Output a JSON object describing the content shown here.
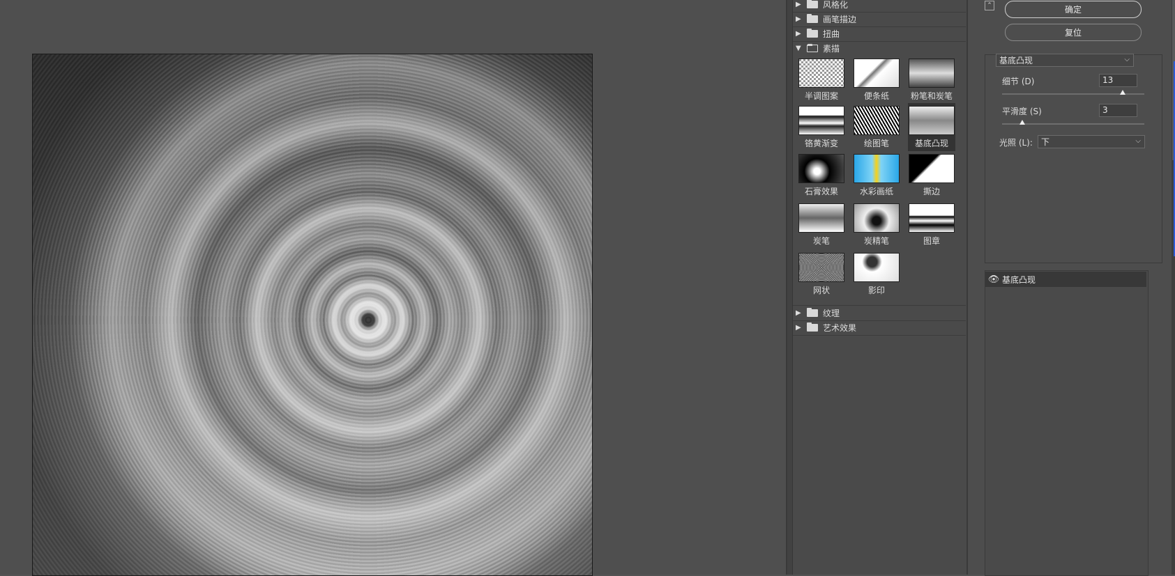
{
  "gallery": {
    "categories_top": [
      {
        "label": "风格化",
        "expanded": false
      },
      {
        "label": "画笔描边",
        "expanded": false
      },
      {
        "label": "扭曲",
        "expanded": false
      },
      {
        "label": "素描",
        "expanded": true
      }
    ],
    "sketch_filters": [
      {
        "label": "半调图案"
      },
      {
        "label": "便条纸"
      },
      {
        "label": "粉笔和炭笔"
      },
      {
        "label": "铬黄渐变"
      },
      {
        "label": "绘图笔"
      },
      {
        "label": "基底凸现",
        "selected": true
      },
      {
        "label": "石膏效果"
      },
      {
        "label": "水彩画纸"
      },
      {
        "label": "撕边"
      },
      {
        "label": "炭笔"
      },
      {
        "label": "炭精笔"
      },
      {
        "label": "图章"
      },
      {
        "label": "网状"
      },
      {
        "label": "影印"
      }
    ],
    "categories_bottom": [
      {
        "label": "纹理",
        "expanded": false
      },
      {
        "label": "艺术效果",
        "expanded": false
      }
    ]
  },
  "settings": {
    "ok_label": "确定",
    "reset_label": "复位",
    "filter_select": "基底凸现",
    "detail_label": "细节 (D)",
    "detail_value": "13",
    "detail_level": 0.85,
    "smoothness_label": "平滑度 (S)",
    "smoothness_value": "3",
    "smoothness_level": 0.14,
    "light_label": "光照 (L):",
    "light_value": "下",
    "layer_name": "基底凸现"
  },
  "colors": {
    "accent_blue": "#2d5bd6"
  }
}
